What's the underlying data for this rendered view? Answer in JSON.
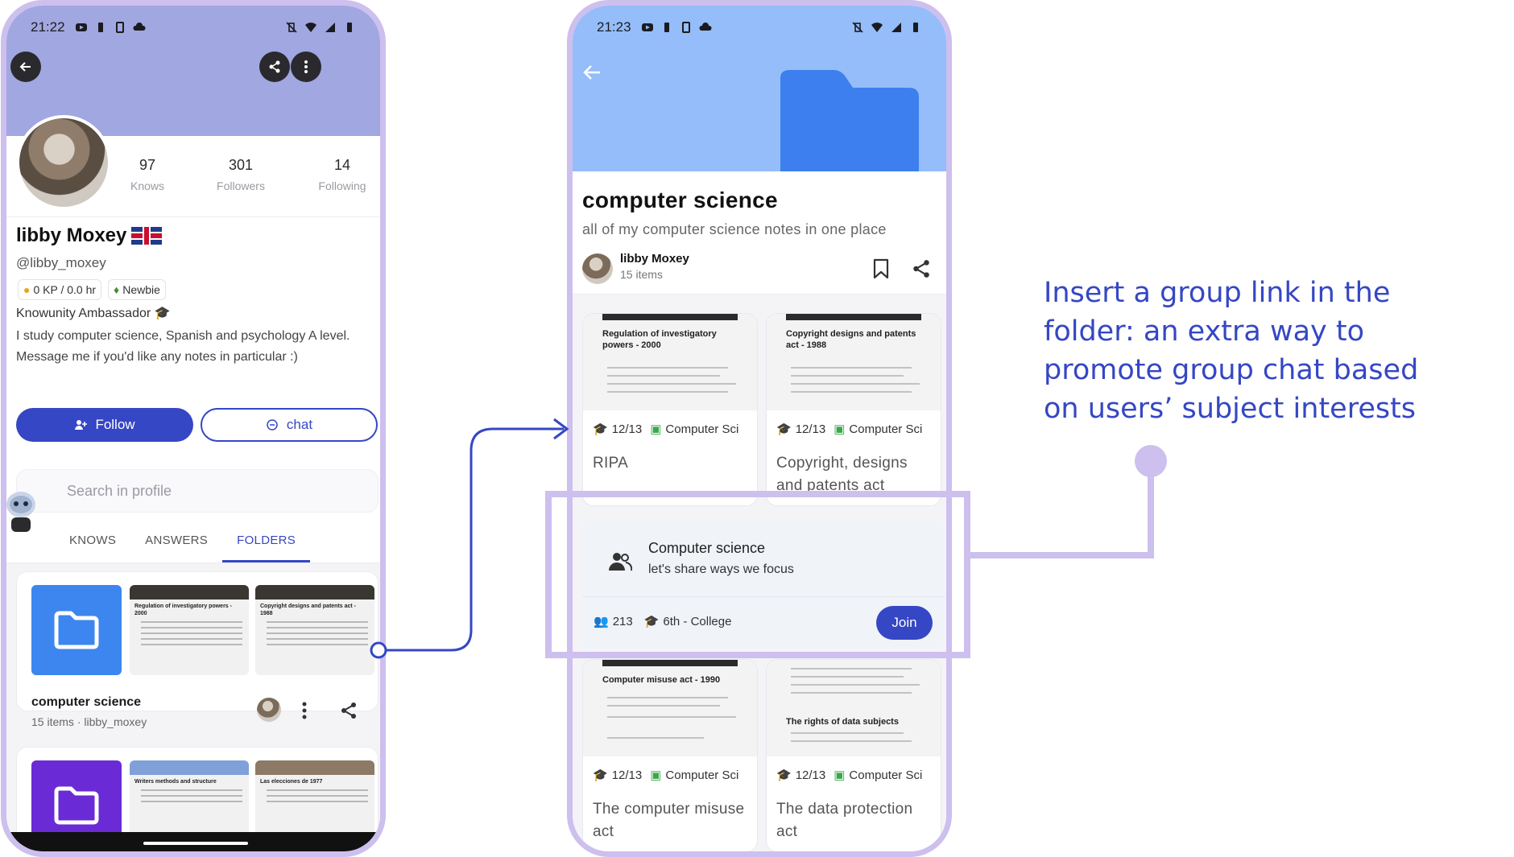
{
  "phone1": {
    "status_time": "21:22",
    "stats": [
      {
        "value": "97",
        "label": "Knows"
      },
      {
        "value": "301",
        "label": "Followers"
      },
      {
        "value": "14",
        "label": "Following"
      }
    ],
    "name": "libby Moxey",
    "handle": "@libby_moxey",
    "badges": [
      "0 KP / 0.0 hr",
      "Newbie"
    ],
    "ambassador": "Knowunity Ambassador 🎓",
    "bio": "I study computer science, Spanish and psychology A level. Message me if you'd like any notes in particular :)",
    "follow_label": "Follow",
    "chat_label": "chat",
    "search_placeholder": "Search in profile",
    "tabs": [
      "KNOWS",
      "ANSWERS",
      "FOLDERS"
    ],
    "active_tab": "FOLDERS",
    "folders": [
      {
        "title": "computer science",
        "items": "15 items",
        "owner": "libby_moxey",
        "color": "#3d86f0",
        "previews": [
          "Regulation of investigatory powers - 2000",
          "Copyright designs and patents act - 1988"
        ]
      },
      {
        "color": "#6a2bd6",
        "previews": [
          "Writers methods and structure",
          "Las elecciones de 1977"
        ]
      }
    ]
  },
  "phone2": {
    "status_time": "21:23",
    "title": "computer science",
    "subtitle": "all of my computer science notes in one place",
    "owner": "libby Moxey",
    "count": "15 items",
    "docs": [
      {
        "preview_title": "Regulation of investigatory powers - 2000",
        "grade": "12/13",
        "subject": "Computer Sci",
        "name": "RIPA"
      },
      {
        "preview_title": "Copyright designs and patents act - 1988",
        "grade": "12/13",
        "subject": "Computer Sci",
        "name": "Copyright, designs and patents act"
      },
      {
        "preview_title": "Computer misuse act - 1990",
        "grade": "12/13",
        "subject": "Computer Sci",
        "name": "The computer misuse act"
      },
      {
        "preview_title": "The rights of data subjects",
        "grade": "12/13",
        "subject": "Computer Sci",
        "name": "The data protection act"
      }
    ],
    "group": {
      "title": "Computer science",
      "subtitle": "let's share ways we focus",
      "members": "213",
      "level": "6th - College",
      "join_label": "Join"
    }
  },
  "annotation": {
    "text": "Insert a group link in the folder: an extra way to promote group chat based on users’ subject interests",
    "color": "#3547c4",
    "highlight_color": "#cdbfee"
  }
}
